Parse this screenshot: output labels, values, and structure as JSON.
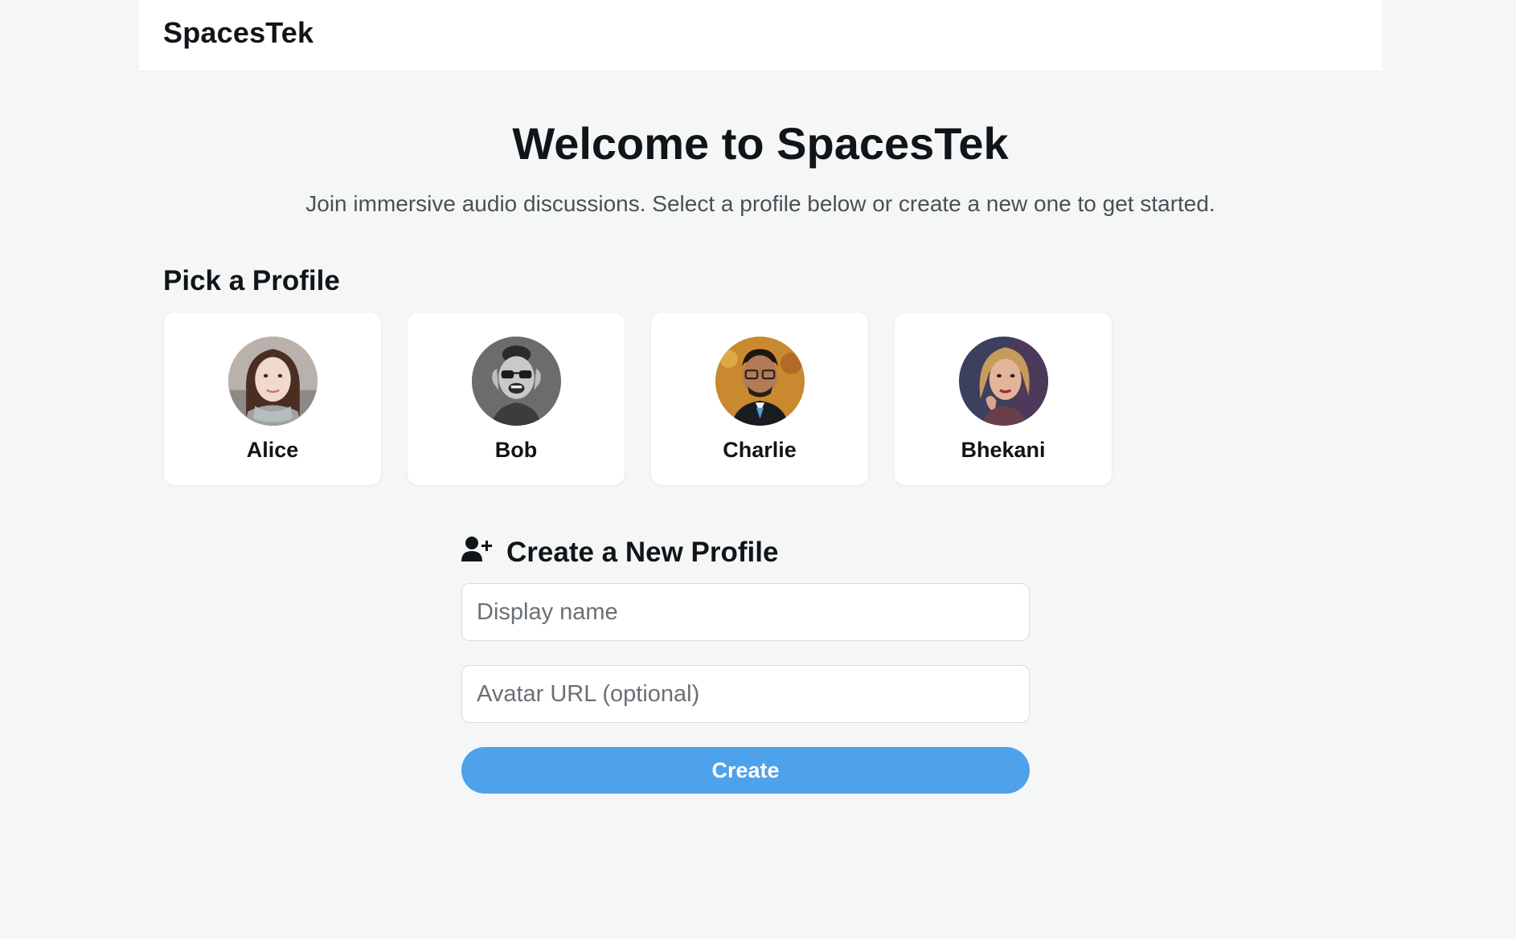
{
  "header": {
    "brand": "SpacesTek"
  },
  "hero": {
    "title": "Welcome to SpacesTek",
    "subtitle": "Join immersive audio discussions. Select a profile below or create a new one to get started."
  },
  "profiles_section": {
    "title": "Pick a Profile",
    "profiles": [
      {
        "name": "Alice",
        "avatar": "avatar-photo-alice"
      },
      {
        "name": "Bob",
        "avatar": "avatar-photo-bob"
      },
      {
        "name": "Charlie",
        "avatar": "avatar-photo-charlie"
      },
      {
        "name": "Bhekani",
        "avatar": "avatar-photo-bhekani"
      }
    ]
  },
  "create_section": {
    "icon": "user-plus-icon",
    "title": "Create a New Profile",
    "display_name_placeholder": "Display name",
    "display_name_value": "",
    "avatar_url_placeholder": "Avatar URL (optional)",
    "avatar_url_value": "",
    "button_label": "Create"
  },
  "colors": {
    "background": "#f5f7f7",
    "accent": "#4ea1eb",
    "text": "#111418",
    "muted_text": "#4b5057"
  }
}
